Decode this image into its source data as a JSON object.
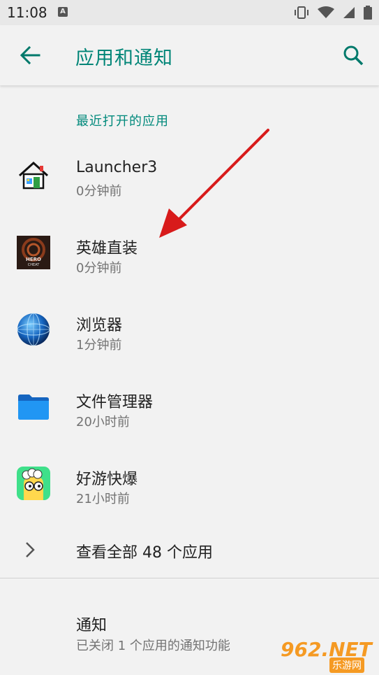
{
  "status_bar": {
    "time": "11:08",
    "notif_letter": "A"
  },
  "app_bar": {
    "title": "应用和通知"
  },
  "recent": {
    "section_title": "最近打开的应用",
    "apps": [
      {
        "name": "Launcher3",
        "time": "0分钟前",
        "icon": "launcher-house-icon"
      },
      {
        "name": "英雄直装",
        "time": "0分钟前",
        "icon": "hero-cheat-icon",
        "icon_text": "HERO CHEAT"
      },
      {
        "name": "浏览器",
        "time": "1分钟前",
        "icon": "browser-globe-icon"
      },
      {
        "name": "文件管理器",
        "time": "20小时前",
        "icon": "folder-icon"
      },
      {
        "name": "好游快爆",
        "time": "21小时前",
        "icon": "haoyou-kuaibao-icon"
      }
    ],
    "see_all": "查看全部 48 个应用"
  },
  "notifications": {
    "title": "通知",
    "subtitle": "已关闭 1 个应用的通知功能"
  },
  "watermark": {
    "main": "962.NET",
    "sub": "乐游网"
  },
  "colors": {
    "accent": "#008577",
    "arrow": "#d81b1b"
  }
}
